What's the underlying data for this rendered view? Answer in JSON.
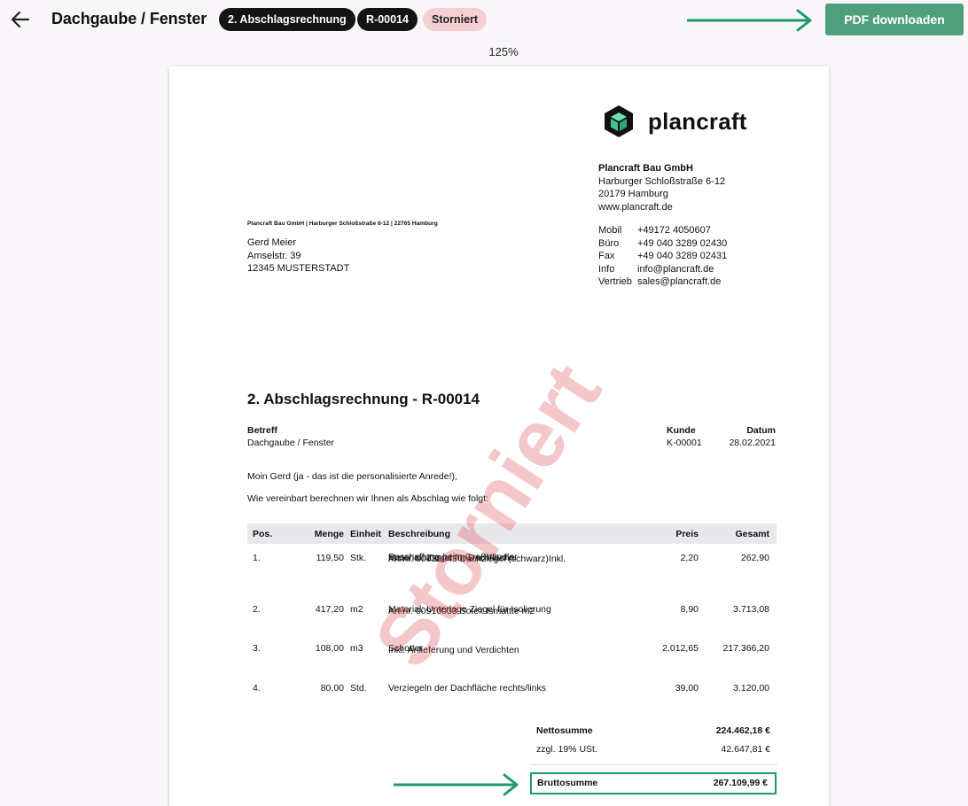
{
  "header": {
    "title": "Dachgaube / Fenster",
    "badges": {
      "type": "2. Abschlagsrechnung",
      "number": "R-00014",
      "status": "Storniert"
    },
    "download_label": "PDF downloaden",
    "zoom": "125%"
  },
  "colors": {
    "accent": "#4ea07c",
    "highlight_border": "#1f9a6d",
    "status_badge": "#f6cfd2",
    "stamp": "#dc4650"
  },
  "document": {
    "logo_text": "plancraft",
    "company": {
      "name": "Plancraft Bau GmbH",
      "street": "Harburger Schloßstraße 6-12",
      "city": "20179 Hamburg",
      "web": "www.plancraft.de"
    },
    "contacts": [
      {
        "label": "Mobil",
        "value": "+49172 4050607"
      },
      {
        "label": "Büro",
        "value": "+49 040 3289 02430"
      },
      {
        "label": "Fax",
        "value": "+49 040 3289 02431"
      },
      {
        "label": "Info",
        "value": "info@plancraft.de"
      },
      {
        "label": "Vertrieb",
        "value": "sales@plancraft.de"
      }
    ],
    "sender_line": "Plancraft Bau GmbH | Harburger Schloßstraße 6-12 | 22765 Hamburg",
    "recipient": {
      "name": "Gerd Meier",
      "street": "Amselstr. 39",
      "city": "12345 MUSTERSTADT"
    },
    "title": "2. Abschlagsrechnung - R-00014",
    "betreff_label": "Betreff",
    "betreff_value": "Dachgaube / Fenster",
    "kunde_label": "Kunde",
    "kunde_value": "K-00001",
    "datum_label": "Datum",
    "datum_value": "28.02.2021",
    "greeting": "Moin Gerd (ja - das ist die personalisierte Anrede!),",
    "intro": "Wie vereinbart berechnen wir Ihnen als Abschlag wie folgt:",
    "columns": {
      "pos": "Pos.",
      "menge": "Menge",
      "einheit": "Einheit",
      "beschreibung": "Beschreibung",
      "preis": "Preis",
      "gesamt": "Gesamt"
    },
    "items": [
      {
        "pos": "1.",
        "menge": "119,50",
        "einheit": "Stk.",
        "desc": "Material: Ziegel für Dachfläche",
        "sub1": "Art.nr. 00930043 Dachziegel (schwarz)Inkl.",
        "sub2": "Beschaffung beim Großhändler",
        "preis": "2,20",
        "gesamt": "262,90"
      },
      {
        "pos": "2.",
        "menge": "417,20",
        "einheit": "m2",
        "desc": "Material: Unterlage Ziegel für Isolierung",
        "sub1": "Art.nr. 00910033 Sotex Ismattte m2",
        "sub2": "",
        "preis": "8,90",
        "gesamt": "3.713,08"
      },
      {
        "pos": "3.",
        "menge": "108,00",
        "einheit": "m3",
        "desc": "Schotter",
        "sub1": "Inkl. Anlieferung und Verdichten",
        "sub2": "",
        "preis": "2.012,65",
        "gesamt": "217.366,20"
      },
      {
        "pos": "4.",
        "menge": "80,00",
        "einheit": "Std.",
        "desc": "Verziegeln der Dachfläche rechts/links",
        "sub1": "",
        "sub2": "",
        "preis": "39,00",
        "gesamt": "3.120,00"
      }
    ],
    "totals": {
      "netto_label": "Nettosumme",
      "netto_value": "224.462,18 €",
      "ust_label": "zzgl. 19% USt.",
      "ust_value": "42.647,81 €",
      "brutto_label": "Bruttosumme",
      "brutto_value": "267.109,99 €"
    },
    "stamp": "Storniert"
  }
}
